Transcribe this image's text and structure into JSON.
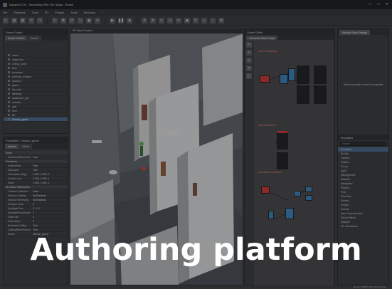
{
  "window": {
    "title": "Narapix3 DTo - Interacting With The Stage - Result",
    "controls": [
      "—",
      "□",
      "✕"
    ]
  },
  "menu": [
    "File",
    "Playback",
    "Tools",
    "3D",
    "Plugins",
    "Tools",
    "Windows",
    "?"
  ],
  "toolbar": {
    "icons": [
      "new-icon",
      "open-icon",
      "save-icon",
      "undo-icon",
      "redo-icon",
      "cursor-icon",
      "move-icon",
      "rotate-icon",
      "scale-icon",
      "camera-icon",
      "light-icon",
      "play-icon",
      "pause-icon",
      "stop-icon",
      "grid-icon",
      "snap-icon",
      "layer-icon",
      "link-icon",
      "cut-icon",
      "paint-icon",
      "brush-icon",
      "zoom-in-icon",
      "zoom-out-icon",
      "settings-icon"
    ],
    "glyphs": [
      "▢",
      "▤",
      "▥",
      "↶",
      "↷",
      "↖",
      "✥",
      "⟳",
      "⤡",
      "◉",
      "☀",
      "▶",
      "❚❚",
      "■",
      "#",
      "⌗",
      "≡",
      "∞",
      "✂",
      "◆",
      "✎",
      "+",
      "−",
      "⚙"
    ]
  },
  "scene_panel": {
    "title": "Scene Graph",
    "tabs": [
      "Scene Content",
      "Assets"
    ],
    "items": [
      "scene",
      "stage_line",
      "ceiling_panel",
      "floor",
      "bookcase",
      "furniture_collision",
      "sconce1",
      "gizmo",
      "ids_wall",
      "lightmap",
      "auditorium_geo",
      "animate",
      "wall",
      "floor",
      "tile",
      "Human_guest"
    ],
    "selected_index": 15
  },
  "properties_panel": {
    "title": "Properties - Human_guest",
    "tabs": [
      "Actions",
      "Fields"
    ],
    "rows": [
      {
        "section": "Entity"
      },
      {
        "key": "Enabled (Behaviour)",
        "value": "True"
      },
      {
        "section": "Transform"
      },
      {
        "key": "IsolNumPos",
        "value": "True"
      },
      {
        "key": "Displayed",
        "value": "True"
      },
      {
        "key": "Orientation (deg)",
        "value": "0.000, 0.000, 0"
      },
      {
        "key": "Position (m)",
        "value": "0.000, 0.000, 1"
      },
      {
        "key": "Scale",
        "value": "1.000, 1.000, 1"
      },
      {
        "section": "3D Model Parameters"
      },
      {
        "key": "Collision Detection",
        "value": "False"
      },
      {
        "key": "Shadow Casting",
        "value": "NoShadows"
      },
      {
        "key": "Shadow Receiving",
        "value": "NoShadows"
      },
      {
        "key": "Shadow Level",
        "value": "0"
      },
      {
        "key": "SpotlightColor",
        "value": "0, 0, 0"
      },
      {
        "key": "SpotlightCloudScale",
        "value": "0"
      },
      {
        "key": "Offset Mtl",
        "value": "0"
      },
      {
        "key": "Reflections",
        "value": "0"
      },
      {
        "key": "Backface Culling",
        "value": "True"
      },
      {
        "key": "CastingWhenFrustum",
        "value": "True"
      },
      {
        "key": "Model",
        "value": "Human_guest"
      }
    ]
  },
  "viewport": {
    "tab": "3D Visual Content"
  },
  "graph_panel": {
    "title": "Graph Editor",
    "tab": "Interactive State Graph",
    "groups": [
      "Scene Interaction",
      "Cam Interaction",
      "Character Interaction"
    ]
  },
  "right_panel": {
    "tab": "Attribute View Settings",
    "message": "Select an entity to see its properties",
    "list_title": "Templates",
    "search_placeholder": "Search",
    "items": [
      "Animation",
      "Bundle",
      "Camera",
      "Entities",
      "Group",
      "Light",
      "Management",
      "Material",
      "Navigation",
      "Physics",
      "Post",
      "Primitives",
      "Scenes",
      "Scripts",
      "Sounds",
      "User Dependencies",
      "Visual Effects",
      "Widgets",
      "VR Interactions"
    ],
    "selected_index": 0
  },
  "status": {
    "right": "Human  PRIMITIVES  Orbit   Outlines"
  },
  "overlay_caption": "Authoring platform",
  "colors": {
    "selection": "#4c6a8d",
    "node_red": "#c73a3a",
    "node_blue": "#3e7eb3",
    "node_dark": "#23252a",
    "caption": "#ffffff"
  }
}
